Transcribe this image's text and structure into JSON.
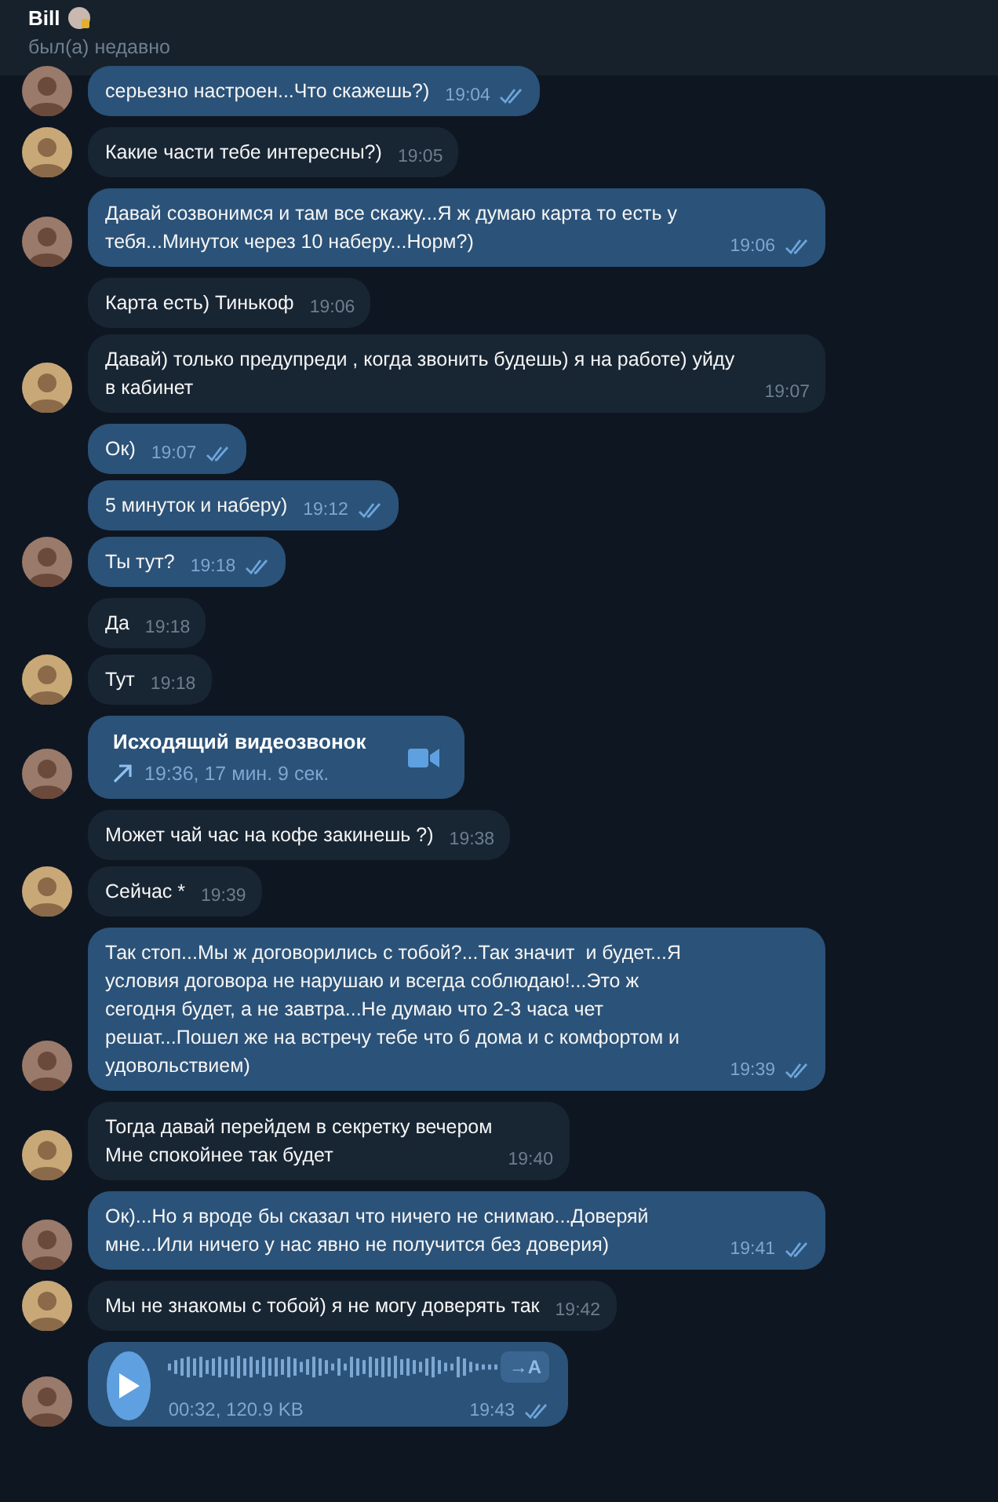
{
  "header": {
    "name": "Bill",
    "status": "был(а) недавно"
  },
  "groups": [
    {
      "outgoing": true,
      "messages": [
        {
          "kind": "text",
          "text": "серьезно настроен...Что скажешь?)",
          "time": "19:04",
          "read": true
        }
      ]
    },
    {
      "outgoing": false,
      "messages": [
        {
          "kind": "text",
          "text": "Какие части тебе интересны?)",
          "time": "19:05"
        }
      ]
    },
    {
      "outgoing": true,
      "messages": [
        {
          "kind": "text",
          "text": "Давай созвонимся и там все скажу...Я ж думаю карта то есть у тебя...Минуток через 10 наберу...Норм?)",
          "time": "19:06",
          "read": true
        }
      ]
    },
    {
      "outgoing": false,
      "messages": [
        {
          "kind": "text",
          "text": "Карта есть) Тинькоф",
          "time": "19:06"
        },
        {
          "kind": "text",
          "text": "Давай) только предупреди , когда звонить будешь) я на работе) уйду в кабинет",
          "time": "19:07"
        }
      ]
    },
    {
      "outgoing": true,
      "messages": [
        {
          "kind": "text",
          "text": "Ок)",
          "time": "19:07",
          "read": true
        },
        {
          "kind": "text",
          "text": "5 минуток и наберу)",
          "time": "19:12",
          "read": true
        },
        {
          "kind": "text",
          "text": "Ты тут?",
          "time": "19:18",
          "read": true
        }
      ]
    },
    {
      "outgoing": false,
      "messages": [
        {
          "kind": "text",
          "text": "Да",
          "time": "19:18"
        },
        {
          "kind": "text",
          "text": "Тут",
          "time": "19:18"
        }
      ]
    },
    {
      "outgoing": true,
      "messages": [
        {
          "kind": "call",
          "title": "Исходящий видеозвонок",
          "details": "19:36, 17 мин. 9 сек."
        }
      ]
    },
    {
      "outgoing": false,
      "messages": [
        {
          "kind": "text",
          "text": "Может чай час на кофе закинешь ?)",
          "time": "19:38"
        },
        {
          "kind": "text",
          "text": "Сейчас *",
          "time": "19:39"
        }
      ]
    },
    {
      "outgoing": true,
      "messages": [
        {
          "kind": "text",
          "text": "Так стоп...Мы ж договорились с тобой?...Так значит  и будет...Я условия договора не нарушаю и всегда соблюдаю!...Это ж сегодня будет, а не завтра...Не думаю что 2-3 часа чет решат...Пошел же на встречу тебе что б дома и с комфортом и удовольствием)",
          "time": "19:39",
          "read": true
        }
      ]
    },
    {
      "outgoing": false,
      "messages": [
        {
          "kind": "text",
          "text": "Тогда давай перейдем в секретку вечером\nМне спокойнее так будет",
          "time": "19:40"
        }
      ]
    },
    {
      "outgoing": true,
      "messages": [
        {
          "kind": "text",
          "text": "Ок)...Но я вроде бы сказал что ничего не снимаю...Доверяй мне...Или ничего у нас явно не получится без доверия)",
          "time": "19:41",
          "read": true
        }
      ]
    },
    {
      "outgoing": false,
      "messages": [
        {
          "kind": "text",
          "text": "Мы не знакомы с тобой) я не могу доверять так",
          "time": "19:42"
        }
      ]
    },
    {
      "outgoing": true,
      "messages": [
        {
          "kind": "voice",
          "info": "00:32, 120.9 KB",
          "transcribe": "→A",
          "time": "19:43",
          "read": true
        }
      ]
    }
  ]
}
